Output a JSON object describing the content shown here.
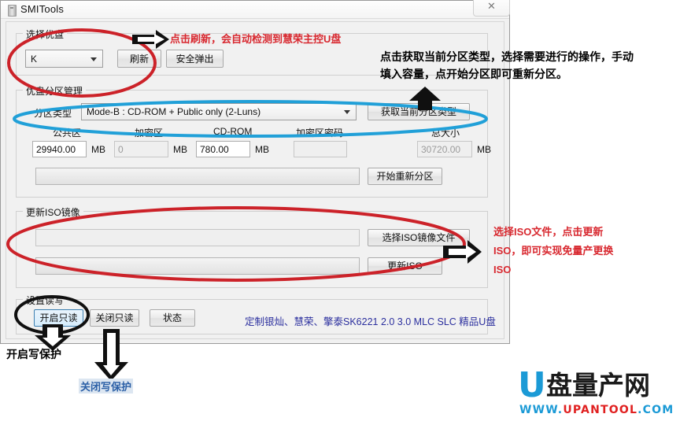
{
  "window": {
    "title": "SMITools",
    "close_label": "✕",
    "icon": "usb-drive-icon"
  },
  "select_drive": {
    "group_title": "选择优盘",
    "combo_value": "K",
    "refresh_button": "刷新",
    "eject_button": "安全弹出"
  },
  "partition": {
    "group_title": "优盘分区管理",
    "type_label": "分区类型",
    "type_value": "Mode-B : CD-ROM + Public only        (2-Luns)",
    "get_type_button": "获取当前分区类型",
    "fields": [
      {
        "label": "公共区",
        "value": "29940.00",
        "unit": "MB",
        "disabled": false
      },
      {
        "label": "加密区",
        "value": "0",
        "unit": "MB",
        "disabled": true
      },
      {
        "label": "CD-ROM",
        "value": "780.00",
        "unit": "MB",
        "disabled": false
      },
      {
        "label": "加密区密码",
        "value": "",
        "unit": "",
        "disabled": true
      },
      {
        "label": "总大小",
        "value": "30720.00",
        "unit": "MB",
        "disabled": true
      }
    ],
    "start_button": "开始重新分区",
    "progress_value": ""
  },
  "iso": {
    "group_title": "更新ISO镜像",
    "path_value": "",
    "select_button": "选择ISO镜像文件",
    "update_button": "更新ISO",
    "progress_value": ""
  },
  "readwrite": {
    "group_title": "设置读写",
    "enable_readonly_button": "开启只读",
    "disable_readonly_button": "关闭只读",
    "status_button": "状态"
  },
  "app_note": "定制银灿、慧荣、擎泰SK6221 2.0 3.0 MLC SLC 精品U盘",
  "annotations": {
    "refresh_note": "点击刷新，会自动检测到慧荣主控U盘",
    "partition_note_line1": "点击获取当前分区类型，选择需要进行的操作，手动",
    "partition_note_line2": "填入容量，点开始分区即可重新分区。",
    "iso_note_line1": "选择ISO文件，点击更新",
    "iso_note_line2": "ISO，即可实现免量产更换",
    "iso_note_line3": "ISO",
    "enable_protect_note": "开启写保护",
    "disable_protect_note": "关闭写保护"
  },
  "logo": {
    "mark": "U",
    "name": "盘量产网",
    "url_www": "WWW.",
    "url_main": "UPANTOOL",
    "url_com": ".COM"
  },
  "colors": {
    "annotation_red": "#d8282f",
    "annotation_blue": "#2b5fa6",
    "app_note_blue": "#2b2f9e",
    "circle_red": "#cc2229",
    "circle_blue": "#21a0d8",
    "circle_black": "#101010",
    "logo_blue": "#1b9ad6",
    "logo_red": "#e02020"
  }
}
